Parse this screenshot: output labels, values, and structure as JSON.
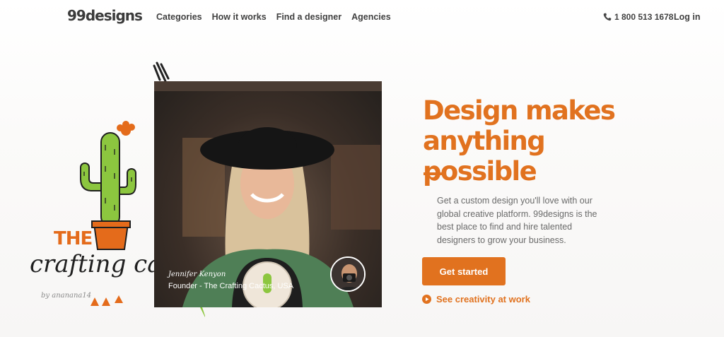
{
  "header": {
    "logo": "99designs",
    "nav": [
      "Categories",
      "How it works",
      "Find a designer",
      "Agencies"
    ],
    "phone": "1 800 513 1678",
    "login": "Log in"
  },
  "illustration": {
    "brand_the": "THE",
    "brand_script": "crafting cac",
    "brand_by": "by ananana14",
    "colors": {
      "accent": "#e46b1b",
      "cactus": "#8cc63f"
    }
  },
  "testimonial": {
    "name": "Jennifer Kenyon",
    "role": "Founder - The Crafting Cactus, USA"
  },
  "hero": {
    "headline": "Design makes anything possible",
    "subcopy": "Get a custom design you'll love with our global creative platform. 99designs is the best place to find and hire talented designers to grow your business.",
    "cta": "Get started",
    "secondary_link": "See creativity at work"
  },
  "colors": {
    "brand": "#e1721f",
    "text": "#2f2f2f",
    "muted": "#6a6a6a"
  }
}
